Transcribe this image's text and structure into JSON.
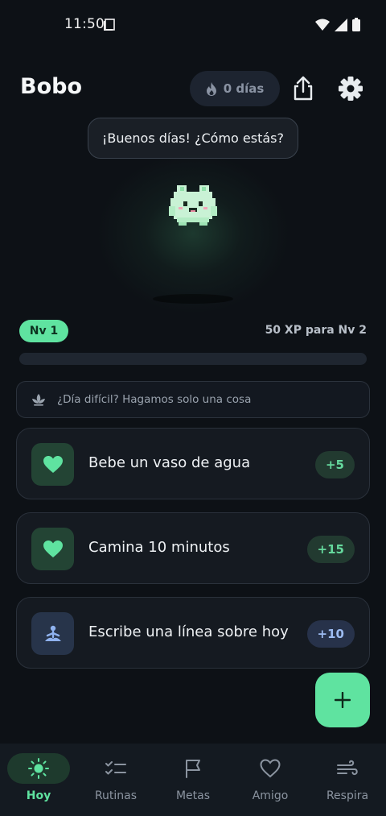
{
  "status_bar": {
    "time": "11:50",
    "icons": [
      "screen-icon",
      "wifi-icon",
      "signal-icon",
      "battery-icon"
    ]
  },
  "header": {
    "title": "Bobo",
    "streak_label": "0 días",
    "streak_icon": "flame-icon",
    "share_icon": "share-icon",
    "settings_icon": "gear-icon"
  },
  "pet": {
    "greeting": "¡Buenos días! ¿Cómo estás?"
  },
  "level": {
    "badge": "Nv 1",
    "xp_text": "50 XP para Nv 2",
    "progress_fraction": 0
  },
  "hint": {
    "text": "¿Día difícil? Hagamos solo una cosa",
    "icon": "lotus-icon"
  },
  "tasks": [
    {
      "label": "Bebe un vaso de agua",
      "xp": "+5",
      "icon": "heart-icon",
      "color": "green"
    },
    {
      "label": "Camina 10 minutos",
      "xp": "+15",
      "icon": "heart-icon",
      "color": "green"
    },
    {
      "label": "Escribe una línea sobre hoy",
      "xp": "+10",
      "icon": "meditation-icon",
      "color": "blue"
    }
  ],
  "fab": {
    "icon": "plus-icon"
  },
  "nav": [
    {
      "label": "Hoy",
      "icon": "sun-icon",
      "active": true
    },
    {
      "label": "Rutinas",
      "icon": "checklist-icon",
      "active": false
    },
    {
      "label": "Metas",
      "icon": "flag-icon",
      "active": false
    },
    {
      "label": "Amigo",
      "icon": "heart-outline-icon",
      "active": false
    },
    {
      "label": "Respira",
      "icon": "wind-icon",
      "active": false
    }
  ],
  "colors": {
    "accent": "#5fe3a0",
    "background": "#0d1116",
    "card": "#151a21"
  }
}
